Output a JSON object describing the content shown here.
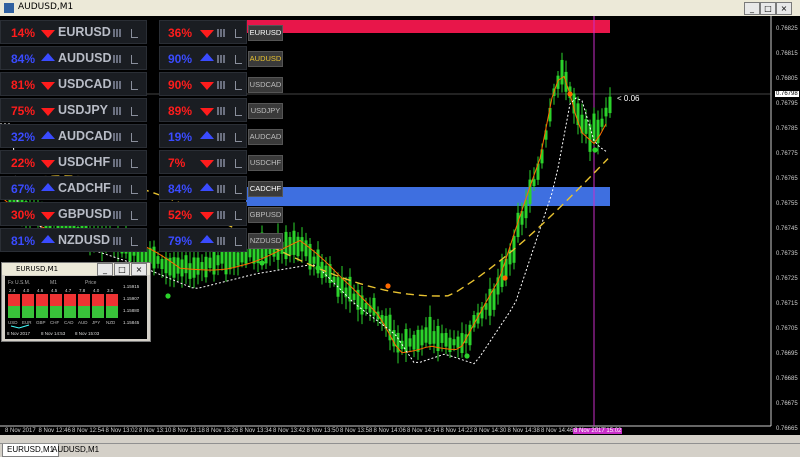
{
  "window": {
    "title": "AUDUSD,M1"
  },
  "pairs": [
    {
      "pct": "14%",
      "sym": "EURUSD",
      "dir": "down",
      "pct2": "36%",
      "dir2": "down",
      "tag": "EURUSD"
    },
    {
      "pct": "84%",
      "sym": "AUDUSD",
      "dir": "up",
      "pct2": "90%",
      "dir2": "up",
      "tag": "AUDUSD"
    },
    {
      "pct": "81%",
      "sym": "USDCAD",
      "dir": "down",
      "pct2": "90%",
      "dir2": "down",
      "tag": "USDCAD"
    },
    {
      "pct": "75%",
      "sym": "USDJPY",
      "dir": "down",
      "pct2": "89%",
      "dir2": "down",
      "tag": "USDJPY"
    },
    {
      "pct": "32%",
      "sym": "AUDCAD",
      "dir": "up",
      "pct2": "19%",
      "dir2": "up",
      "tag": "AUDCAD"
    },
    {
      "pct": "22%",
      "sym": "USDCHF",
      "dir": "down",
      "pct2": "7%",
      "dir2": "down",
      "tag": "USDCHF"
    },
    {
      "pct": "67%",
      "sym": "CADCHF",
      "dir": "up",
      "pct2": "84%",
      "dir2": "up",
      "tag": "CADCHF"
    },
    {
      "pct": "30%",
      "sym": "GBPUSD",
      "dir": "down",
      "pct2": "52%",
      "dir2": "down",
      "tag": "GBPUSD"
    },
    {
      "pct": "81%",
      "sym": "NZDUSD",
      "dir": "up",
      "pct2": "79%",
      "dir2": "up",
      "tag": "NZDUSD"
    }
  ],
  "colors": {
    "up": "#3a4bff",
    "down": "#ff1c1c",
    "candle": "#2bd32b",
    "band_red": "#e8164a",
    "band_blue": "#3e6fe0"
  },
  "price_axis": [
    "0.76825",
    "0.76815",
    "0.76805",
    "0.76795",
    "0.76785",
    "0.76775",
    "0.76765",
    "0.76755",
    "0.76745",
    "0.76735",
    "0.76725",
    "0.76715",
    "0.76705",
    "0.76695",
    "0.76685",
    "0.76675",
    "0.76665"
  ],
  "current_price": "0.76798",
  "annotation": "< 0.06",
  "time_axis": [
    "8 Nov 2017",
    "8 Nov 12:46",
    "8 Nov 12:54",
    "8 Nov 13:02",
    "8 Nov 13:10",
    "8 Nov 13:18",
    "8 Nov 13:26",
    "8 Nov 13:34",
    "8 Nov 13:42",
    "8 Nov 13:50",
    "8 Nov 13:58",
    "8 Nov 14:06",
    "8 Nov 14:14",
    "8 Nov 14:22",
    "8 Nov 14:30",
    "8 Nov 14:38",
    "8 Nov 14:46",
    "8 Nov 15:02"
  ],
  "cursor_time": "8 Nov 2017 15:02",
  "mini": {
    "title": "EURUSD,M1",
    "header": "Fx U.S.M.",
    "tf": "M1",
    "price_label": "Price",
    "vals": [
      "2.4",
      "4.0",
      "4.6",
      "4.5",
      "4.7",
      "7.8",
      "4.0",
      "3.0"
    ],
    "ccys": [
      "USD",
      "EUR",
      "GBP",
      "CHF",
      "CAD",
      "AUD",
      "JPY",
      "NZD"
    ],
    "prices": [
      "1.15915",
      "1.15907",
      "1.15880",
      "1.15845"
    ],
    "times": [
      "8 Nov 2017",
      "8 Nov 14:53",
      "8 Nov 15:03"
    ]
  },
  "tabs": [
    "EURUSD,M1",
    "AUDUSD,M1"
  ]
}
